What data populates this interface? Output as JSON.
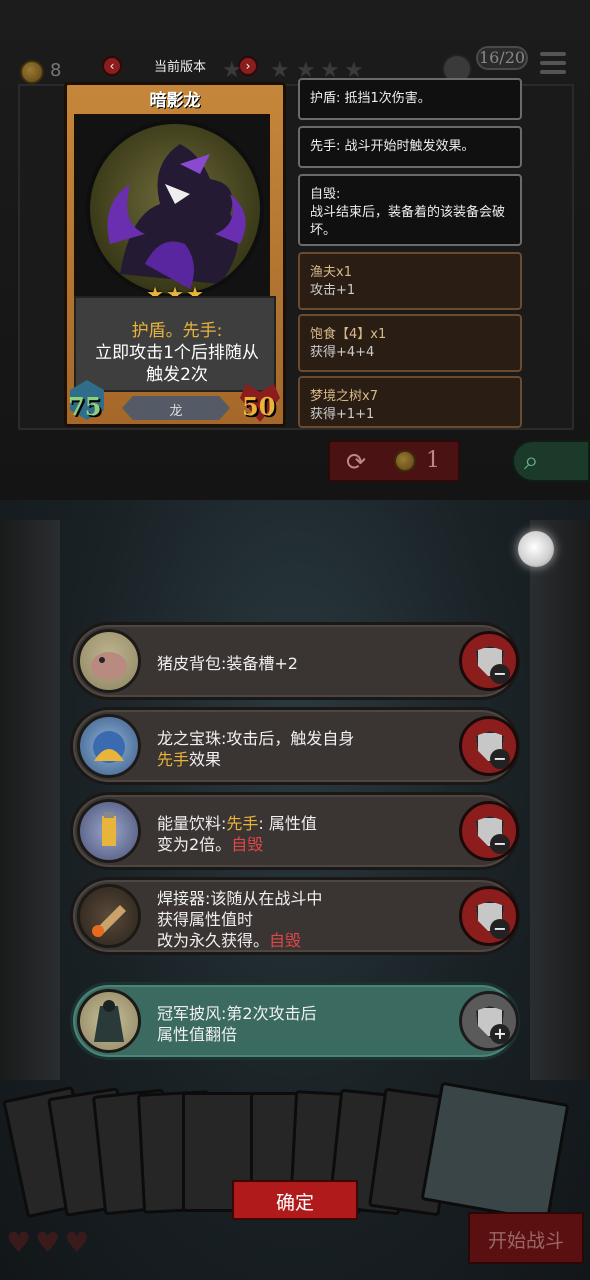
{
  "header": {
    "coin_count": "8",
    "version_label": "当前版本",
    "prev_icon": "chevron-left-icon",
    "next_icon": "chevron-right-icon",
    "turn_counter": "16/20",
    "menu_icon": "menu-icon"
  },
  "card": {
    "title": "暗影龙",
    "stars": "★★★",
    "desc_line1": "护盾。先手:",
    "desc_line2": "立即攻击1个后排随从",
    "desc_line3": "触发2次",
    "attack": "75",
    "health": "50",
    "tribe": "龙"
  },
  "tooltips": [
    {
      "title": "",
      "text": "护盾: 抵挡1次伤害。"
    },
    {
      "title": "",
      "text": "先手: 战斗开始时触发效果。"
    },
    {
      "title": "自毁:",
      "text": "战斗结束后，装备着的该装备会破坏。"
    },
    {
      "title": "渔夫x1",
      "text": "攻击+1"
    },
    {
      "title": "饱食【4】x1",
      "text": "获得+4+4"
    },
    {
      "title": "梦境之树x7",
      "text": "获得+1+1"
    }
  ],
  "reroll": {
    "cost": "1"
  },
  "equipment": [
    {
      "name": "猪皮背包",
      "line1": "猪皮背包:装备槽+2",
      "line2": "",
      "line3": "",
      "action": "remove"
    },
    {
      "name": "龙之宝珠",
      "line1": "龙之宝珠:攻击后，触发自身",
      "line2_hl": "先手",
      "line2_rest": "效果",
      "action": "remove"
    },
    {
      "name": "能量饮料",
      "line1_a": "能量饮料:",
      "line1_hl": "先手",
      "line1_b": ":  属性值",
      "line2_a": "变为2倍。",
      "line2_rd": "自毁",
      "action": "remove"
    },
    {
      "name": "焊接器",
      "line1": "焊接器:该随从在战斗中",
      "line2": "获得属性值时",
      "line3_a": "改为永久获得。",
      "line3_rd": "自毁",
      "action": "remove"
    },
    {
      "name": "冠军披风",
      "line1": "冠军披风:第2次攻击后",
      "line2": "属性值翻倍",
      "action": "add"
    }
  ],
  "buttons": {
    "confirm": "确定",
    "start_battle": "开始战斗"
  },
  "colors": {
    "highlight": "#e8b43a",
    "self_destruct": "#e04848",
    "remove_button": "#8c1d1d",
    "add_row": "#3a6a60"
  }
}
